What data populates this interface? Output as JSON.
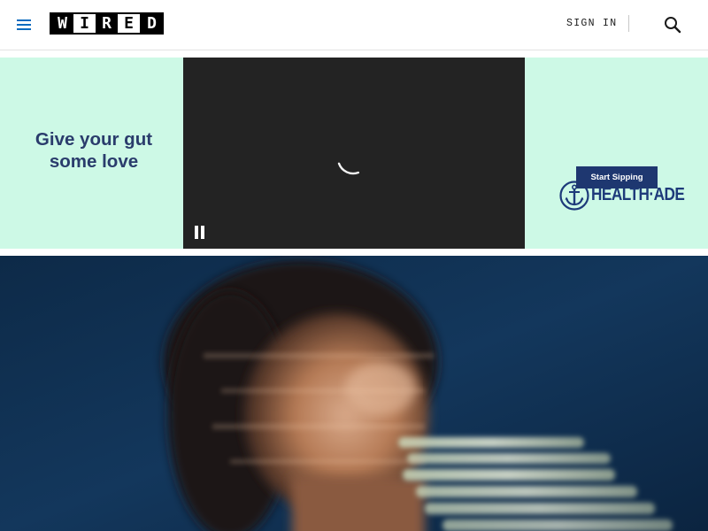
{
  "header": {
    "menu_icon": "hamburger-menu-icon",
    "logo": {
      "letters": [
        "W",
        "I",
        "R",
        "E",
        "D"
      ]
    },
    "signin_label": "SIGN IN",
    "search_icon": "search-icon",
    "colors": {
      "accent": "#0a6bbf",
      "text": "#1a1a1a"
    }
  },
  "ad": {
    "tagline_line1": "Give your gut",
    "tagline_line2": "some love",
    "brand_name": "HEALTH·ADE",
    "brand_icon": "anchor-icon",
    "cta_label": "Start Sipping",
    "video_state_icon": "loading-spinner-icon",
    "pause_icon": "pause-icon",
    "colors": {
      "background": "#cdf9e6",
      "brand": "#1e3770",
      "video": "#232323"
    }
  },
  "hero": {
    "image": "blurred-portrait-photo"
  }
}
